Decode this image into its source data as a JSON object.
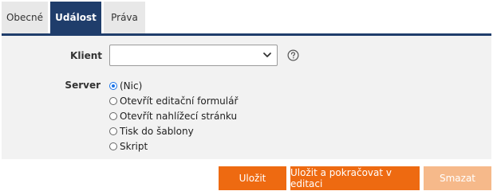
{
  "tabs": [
    {
      "label": "Obecné",
      "active": false
    },
    {
      "label": "Událost",
      "active": true
    },
    {
      "label": "Práva",
      "active": false
    }
  ],
  "form": {
    "klient": {
      "label": "Klient",
      "value": "",
      "help_icon": "question-circle-icon"
    },
    "server": {
      "label": "Server",
      "options": [
        {
          "label": "(Nic)",
          "checked": true
        },
        {
          "label": "Otevřít editační formulář",
          "checked": false
        },
        {
          "label": "Otevřít nahlížecí stránku",
          "checked": false
        },
        {
          "label": "Tisk do šablony",
          "checked": false
        },
        {
          "label": "Skript",
          "checked": false
        }
      ]
    }
  },
  "buttons": {
    "save": "Uložit",
    "save_continue": "Uložit a pokračovat v editaci",
    "delete": "Smazat"
  },
  "colors": {
    "tab_active": "#1f3d6b",
    "accent_orange": "#ee6a11",
    "disabled_orange": "#f6b98a",
    "panel_bg": "#f2f2f2"
  }
}
